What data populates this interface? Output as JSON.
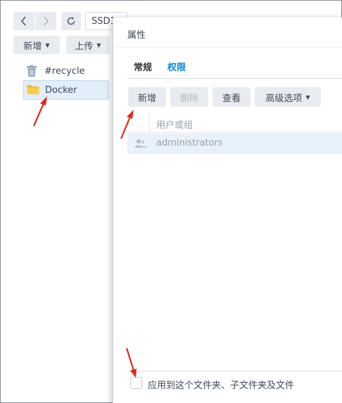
{
  "toolbar": {
    "path_text": "SSD1",
    "create_label": "新增",
    "upload_label": "上传"
  },
  "tree": {
    "items": [
      {
        "label": "#recycle",
        "icon": "trash-icon"
      },
      {
        "label": "Docker",
        "icon": "folder-icon",
        "selected": true
      }
    ]
  },
  "dialog": {
    "title": "属性",
    "tabs": [
      {
        "label": "常规",
        "active": false
      },
      {
        "label": "权限",
        "active": true
      }
    ],
    "buttons": {
      "create": "新增",
      "delete": "删除",
      "view": "查看",
      "advanced": "高级选项"
    },
    "table": {
      "header": "用户或组",
      "rows": [
        {
          "name": "administrators",
          "icon": "group-icon"
        }
      ]
    },
    "apply_label": "应用到这个文件夹、子文件夹及文件",
    "apply_checked": false
  },
  "colors": {
    "accent": "#0086e5",
    "annotation": "#e8261c",
    "selected_row": "#e9f1fa",
    "button_bg": "#e8ecf0"
  }
}
